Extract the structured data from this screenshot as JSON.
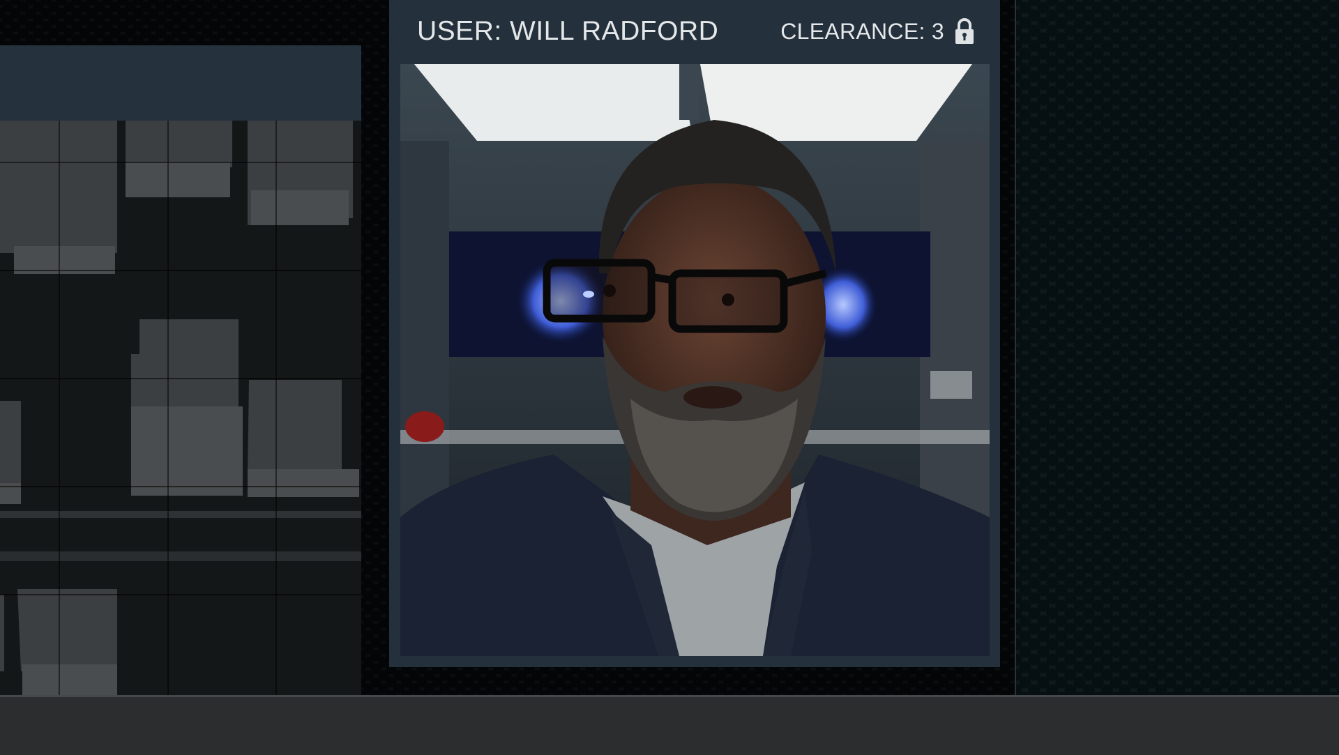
{
  "card": {
    "user_label": "USER: WILL RADFORD",
    "clearance_label": "CLEARANCE: 3",
    "lock_icon": "lock-icon"
  },
  "colors": {
    "panel": "#24303b",
    "text": "#e5e8ea",
    "map_header": "#25313c",
    "map_block": "#3a3d3f",
    "bottom_bar": "#2b2d2e"
  }
}
